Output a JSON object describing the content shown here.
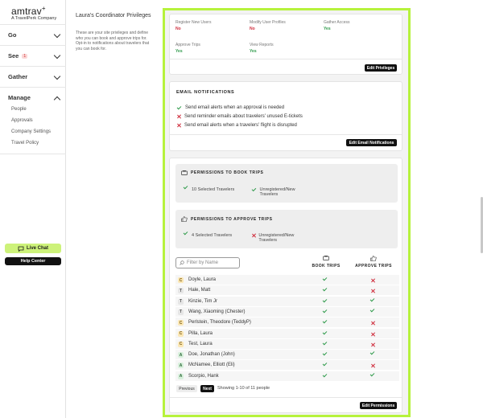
{
  "brand": {
    "name": "amtrav",
    "plus": "+",
    "tagline": "A TravelPerk Company"
  },
  "sidebar": {
    "nav": [
      {
        "label": "Go"
      },
      {
        "label": "See",
        "badge": "1"
      },
      {
        "label": "Gather"
      },
      {
        "label": "Manage"
      }
    ],
    "manage_items": [
      "People",
      "Approvals",
      "Company Settings",
      "Travel Policy"
    ],
    "live_chat": "Live Chat",
    "help_center": "Help Center"
  },
  "section": {
    "title": "Laura's Coordinator Privileges",
    "description": "These are your site privileges and define who you can book and approve trips for. Opt-in to notifications about travelers that you can book for."
  },
  "privileges": {
    "items": [
      {
        "label": "Register New Users",
        "value": "No"
      },
      {
        "label": "Modify User Profiles",
        "value": "No"
      },
      {
        "label": "Gather Access",
        "value": "Yes"
      },
      {
        "label": "Approve Trips",
        "value": "Yes"
      },
      {
        "label": "View Reports",
        "value": "Yes"
      }
    ],
    "edit_button": "Edit Privileges"
  },
  "email": {
    "heading": "EMAIL NOTIFICATIONS",
    "items": [
      {
        "text": "Send email alerts when an approval is needed",
        "enabled": true
      },
      {
        "text": "Send reminder emails about travelers' unused E-tickets",
        "enabled": false
      },
      {
        "text": "Send email alerts when a travelers' flight is disrupted",
        "enabled": false
      }
    ],
    "edit_button": "Edit Email Notifications"
  },
  "permissions": {
    "book": {
      "heading": "PERMISSIONS TO BOOK TRIPS",
      "selected": "10 Selected Travelers",
      "unregistered": "Unregistered/New Travelers",
      "unregistered_enabled": true
    },
    "approve": {
      "heading": "PERMISSIONS TO APPROVE TRIPS",
      "selected": "4 Selected Travelers",
      "unregistered": "Unregistered/New Travelers",
      "unregistered_enabled": false
    },
    "filter_placeholder": "Filter by Name",
    "col_book": "BOOK TRIPS",
    "col_approve": "APPROVE TRIPS",
    "travelers": [
      {
        "initial": "C",
        "name": "Doyle, Laura",
        "book": true,
        "approve": false
      },
      {
        "initial": "T",
        "name": "Hale, Matt",
        "book": true,
        "approve": false
      },
      {
        "initial": "T",
        "name": "Kinzie, Tim Jr",
        "book": true,
        "approve": true
      },
      {
        "initial": "T",
        "name": "Wang, Xiaoming (Chester)",
        "book": true,
        "approve": true
      },
      {
        "initial": "C",
        "name": "Perlstein, Theodore (TeddyP)",
        "book": true,
        "approve": false
      },
      {
        "initial": "C",
        "name": "Pilla, Laura",
        "book": true,
        "approve": false
      },
      {
        "initial": "C",
        "name": "Test, Laura",
        "book": true,
        "approve": false
      },
      {
        "initial": "A",
        "name": "Doe, Jonathan (John)",
        "book": true,
        "approve": true
      },
      {
        "initial": "A",
        "name": "McNamee, Elliott (Eli)",
        "book": true,
        "approve": false
      },
      {
        "initial": "A",
        "name": "Scorpio, Hank",
        "book": true,
        "approve": true
      }
    ],
    "pagination": {
      "previous": "Previous",
      "next": "Next",
      "summary": "Showing 1-10 of 11 people"
    },
    "edit_button": "Edit Permissions"
  },
  "colors": {
    "accent": "#b6f23c",
    "yes": "#2e9a4a",
    "no": "#d0303f",
    "live_chat": "#cdf27a"
  }
}
